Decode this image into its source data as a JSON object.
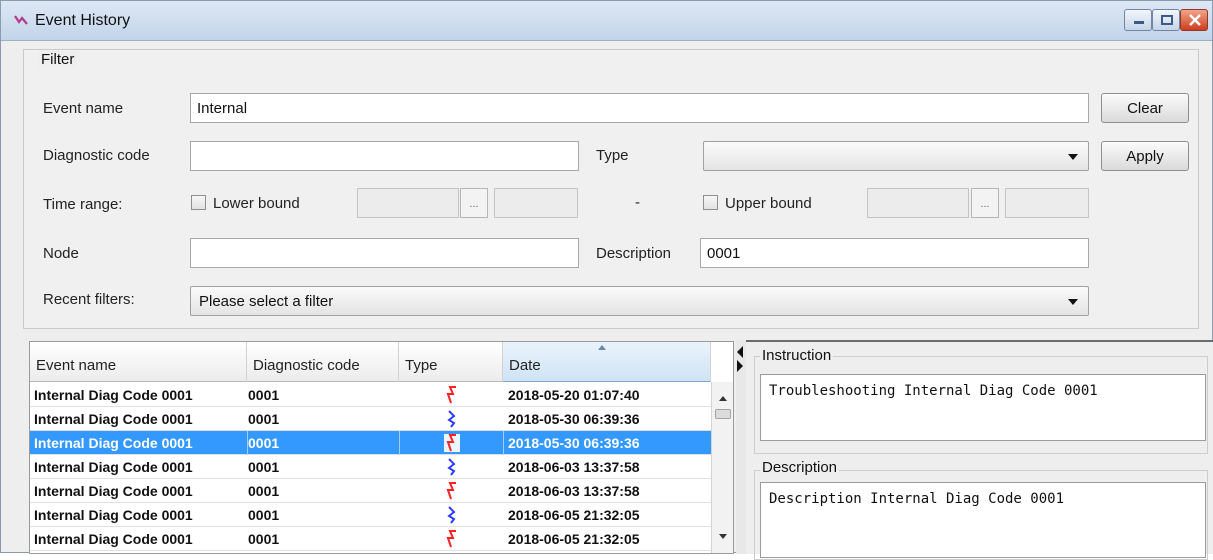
{
  "window": {
    "title": "Event History"
  },
  "filter": {
    "group_label": "Filter",
    "event_name": {
      "label": "Event name",
      "value": "Internal"
    },
    "diagnostic_code": {
      "label": "Diagnostic code",
      "value": ""
    },
    "type": {
      "label": "Type",
      "value": ""
    },
    "time_range": {
      "label": "Time range:",
      "lower_label": "Lower bound",
      "upper_label": "Upper bound",
      "separator": "-",
      "dots": "..."
    },
    "node": {
      "label": "Node",
      "value": ""
    },
    "description": {
      "label": "Description",
      "value": "0001"
    },
    "recent": {
      "label": "Recent filters:",
      "value": "Please select a filter"
    },
    "clear_label": "Clear",
    "apply_label": "Apply"
  },
  "table": {
    "columns": [
      "Event name",
      "Diagnostic code",
      "Type",
      "Date"
    ],
    "rows": [
      {
        "name": "Internal Diag Code 0001",
        "code": "0001",
        "type": "raise",
        "date": "2018-05-20 01:07:40"
      },
      {
        "name": "Internal Diag Code 0001",
        "code": "0001",
        "type": "clear",
        "date": "2018-05-30 06:39:36"
      },
      {
        "name": "Internal Diag Code 0001",
        "code": "0001",
        "type": "raise",
        "date": "2018-05-30 06:39:36",
        "selected": true
      },
      {
        "name": "Internal Diag Code 0001",
        "code": "0001",
        "type": "clear",
        "date": "2018-06-03 13:37:58"
      },
      {
        "name": "Internal Diag Code 0001",
        "code": "0001",
        "type": "raise",
        "date": "2018-06-03 13:37:58"
      },
      {
        "name": "Internal Diag Code 0001",
        "code": "0001",
        "type": "clear",
        "date": "2018-06-05 21:32:05"
      },
      {
        "name": "Internal Diag Code 0001",
        "code": "0001",
        "type": "raise",
        "date": "2018-06-05 21:32:05"
      }
    ]
  },
  "details": {
    "instruction_label": "Instruction",
    "instruction_text": "Troubleshooting Internal Diag Code 0001",
    "description_label": "Description",
    "description_text": "Description Internal Diag Code 0001"
  },
  "colors": {
    "selection": "#3399ff",
    "raise_icon": "#ff2020",
    "clear_icon": "#2d3cff"
  }
}
